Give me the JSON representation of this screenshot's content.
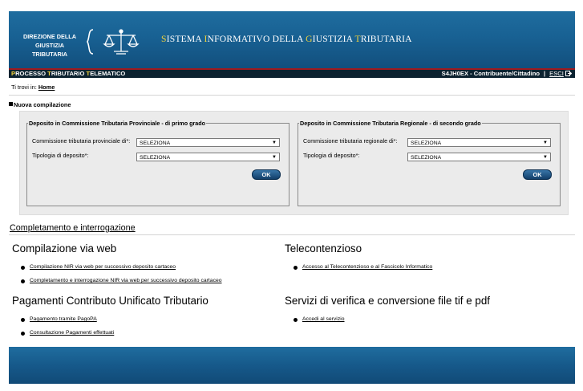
{
  "header": {
    "department_line1": "DIREZIONE DELLA",
    "department_line2": "GIUSTIZIA TRIBUTARIA",
    "system_title": [
      {
        "cap": "S",
        "rest": "ISTEMA "
      },
      {
        "cap": "I",
        "rest": "NFORMATIVO DELLA "
      },
      {
        "cap": "G",
        "rest": "IUSTIZIA "
      },
      {
        "cap": "T",
        "rest": "RIBUTARIA"
      }
    ],
    "logo_icon": "scales-of-justice-icon"
  },
  "navbar": {
    "title_parts": [
      {
        "cap": "P",
        "rest": "ROCESSO "
      },
      {
        "cap": "T",
        "rest": "RIBUTARIO "
      },
      {
        "cap": "T",
        "rest": "ELEMATICO"
      }
    ],
    "user": "S4JH0EX - Contribuente/Cittadino",
    "separator": "|",
    "logout": "ESCI",
    "logout_icon": "exit-icon"
  },
  "breadcrumb": {
    "prefix": "Ti trovi in:",
    "home": "Home"
  },
  "new_compilation": {
    "title": "Nuova compilazione",
    "provincial": {
      "legend": "Deposito in Commissione Tributaria Provinciale - di primo grado",
      "commission_label": "Commissione tributaria provinciale di*:",
      "commission_value": "SELEZIONA",
      "type_label": "Tipologia di deposito*:",
      "type_value": "SELEZIONA",
      "ok": "OK"
    },
    "regional": {
      "legend": "Deposito in Commissione Tributaria Regionale - di secondo grado",
      "commission_label": "Commissione tributaria regionale di*:",
      "commission_value": "SELEZIONA",
      "type_label": "Tipologia di deposito*:",
      "type_value": "SELEZIONA",
      "ok": "OK"
    }
  },
  "completion_link": "Completamento e interrogazione",
  "sections": {
    "web": {
      "title": "Compilazione via web",
      "links": [
        "Compilazione NIR via web per successivo deposito cartaceo",
        "Completamento e interrogazione NIR via web per successivo deposito cartaceo"
      ]
    },
    "telecontenzioso": {
      "title": "Telecontenzioso",
      "links": [
        "Accesso al Telecontenzioso e al Fascicolo Informatico"
      ]
    },
    "payments": {
      "title": "Pagamenti Contributo Unificato Tributario",
      "links": [
        "Pagamento tramite PagoPA",
        "Consultazione Pagamenti effettuati"
      ]
    },
    "verification": {
      "title": "Servizi di verifica e conversione file tif e pdf",
      "links": [
        "Accedi al servizio"
      ]
    }
  },
  "colors": {
    "header_blue": "#186193",
    "accent_yellow": "#f2d33b",
    "navbar_dark": "#0c2230",
    "ok_button": "#1b4d7e"
  }
}
